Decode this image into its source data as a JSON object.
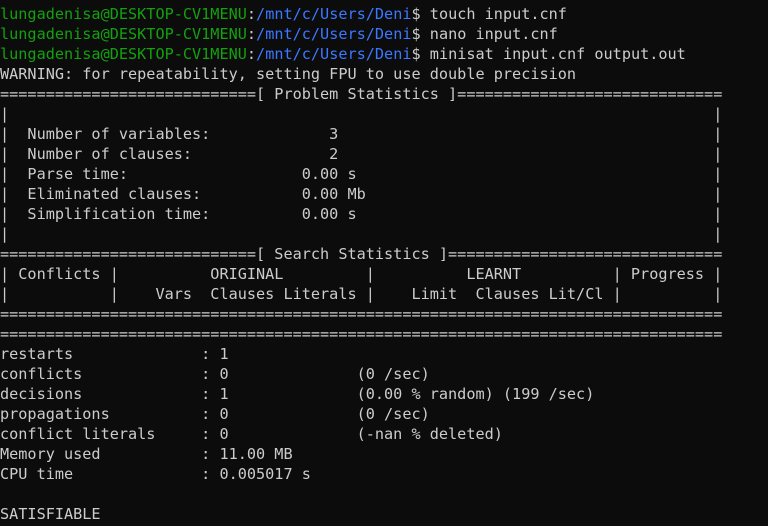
{
  "colors": {
    "background": "#0c0c0c",
    "text": "#cccccc",
    "user_host": "#13a10e",
    "path": "#3b78ff"
  },
  "prompts": [
    {
      "user_host": "lungadenisa@DESKTOP-CV1MENU",
      "sep": ":",
      "path": "/mnt/c/Users/Deni",
      "symbol": "$ ",
      "command": "touch input.cnf"
    },
    {
      "user_host": "lungadenisa@DESKTOP-CV1MENU",
      "sep": ":",
      "path": "/mnt/c/Users/Deni",
      "symbol": "$ ",
      "command": "nano input.cnf"
    },
    {
      "user_host": "lungadenisa@DESKTOP-CV1MENU",
      "sep": ":",
      "path": "/mnt/c/Users/Deni",
      "symbol": "$ ",
      "command": "minisat input.cnf output.out"
    }
  ],
  "output_lines": [
    "WARNING: for repeatability, setting FPU to use double precision",
    "============================[ Problem Statistics ]=============================",
    "|                                                                             |",
    "|  Number of variables:             3                                         |",
    "|  Number of clauses:               2                                         |",
    "|  Parse time:                   0.00 s                                       |",
    "|  Eliminated clauses:           0.00 Mb                                      |",
    "|  Simplification time:          0.00 s                                       |",
    "|                                                                             |",
    "============================[ Search Statistics ]==============================",
    "| Conflicts |          ORIGINAL         |          LEARNT          | Progress |",
    "|           |    Vars  Clauses Literals |    Limit  Clauses Lit/Cl |          |",
    "===============================================================================",
    "===============================================================================",
    "restarts              : 1",
    "conflicts             : 0              (0 /sec)",
    "decisions             : 1              (0.00 % random) (199 /sec)",
    "propagations          : 0              (0 /sec)",
    "conflict literals     : 0              (-nan % deleted)",
    "Memory used           : 11.00 MB",
    "CPU time              : 0.005017 s",
    "",
    "SATISFIABLE"
  ]
}
